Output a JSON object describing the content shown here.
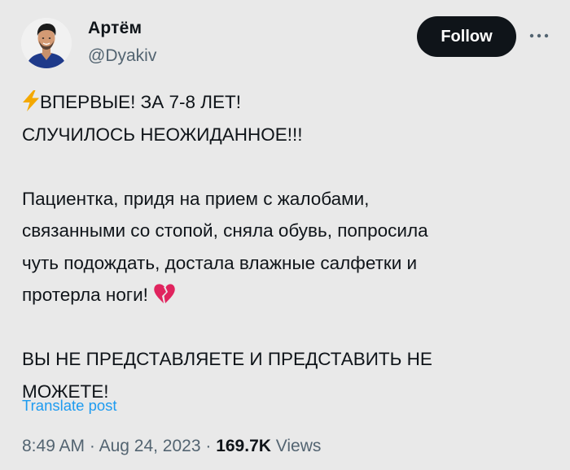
{
  "author": {
    "name": "Артём",
    "handle": "@Dyakiv",
    "avatar_icon": "person-avatar"
  },
  "actions": {
    "follow_label": "Follow",
    "more_icon": "more-dots-icon"
  },
  "tweet": {
    "line_1": "ВПЕРВЫЕ! ЗА 7-8 ЛЕТ!",
    "line_1_emoji": "high-voltage-emoji",
    "line_2": "СЛУЧИЛОСЬ НЕОЖИДАННОЕ!!!",
    "line_3": "Пациентка, придя на прием с жалобами,",
    "line_4": "связанными со стопой, сняла обувь, попросила",
    "line_5": "чуть подождать, достала влажные салфетки и",
    "line_6": "протерла ноги!",
    "line_6_emoji": "broken-heart-emoji",
    "line_7": "ВЫ НЕ ПРЕДСТАВЛЯЕТЕ И ПРЕДСТАВИТЬ НЕ",
    "line_8": "МОЖЕТЕ!"
  },
  "translate": {
    "label": "Translate post"
  },
  "meta": {
    "time": "8:49 AM",
    "separator": " · ",
    "date": "Aug 24, 2023",
    "views_count": "169.7K",
    "views_label": " Views"
  },
  "colors": {
    "background": "#e9e9e9",
    "text_primary": "#0f1419",
    "text_secondary": "#536471",
    "link": "#1d9bf0",
    "button_bg": "#0f1419",
    "button_text": "#ffffff"
  }
}
